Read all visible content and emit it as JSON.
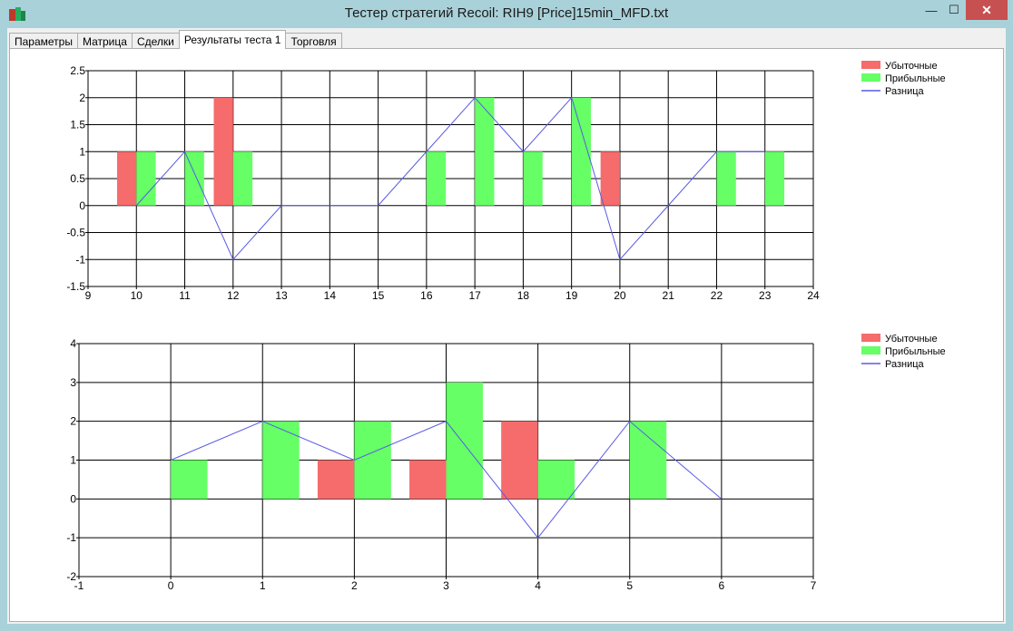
{
  "window": {
    "title": "Тестер стратегий Recoil: RIH9 [Price]15min_MFD.txt",
    "controls": {
      "minimize": "—",
      "maximize": "☐",
      "close": "✕"
    }
  },
  "tabs": [
    {
      "label": "Параметры",
      "active": false
    },
    {
      "label": "Матрица",
      "active": false
    },
    {
      "label": "Сделки",
      "active": false
    },
    {
      "label": "Результаты теста 1",
      "active": true
    },
    {
      "label": "Торговля",
      "active": false
    }
  ],
  "colors": {
    "loss": "#f66b6b",
    "profit": "#66ff66",
    "diff": "#5a5ae6",
    "grid": "#000000"
  },
  "chart_data": [
    {
      "type": "bar",
      "xlim": [
        9,
        24
      ],
      "ylim": [
        -1.5,
        2.5
      ],
      "xticks": [
        "9",
        "10",
        "11",
        "12",
        "13",
        "14",
        "15",
        "16",
        "17",
        "18",
        "19",
        "20",
        "21",
        "22",
        "23",
        "24"
      ],
      "yticks": [
        "2.5",
        "2",
        "1.5",
        "1",
        "0.5",
        "0",
        "-0.5",
        "-1",
        "-1.5"
      ],
      "xtick_values": [
        9,
        10,
        11,
        12,
        13,
        14,
        15,
        16,
        17,
        18,
        19,
        20,
        21,
        22,
        23,
        24
      ],
      "ytick_values": [
        2.5,
        2,
        1.5,
        1,
        0.5,
        0,
        -0.5,
        -1,
        -1.5
      ],
      "bar_width": 0.4,
      "legend": {
        "placement": "top-right"
      },
      "series": [
        {
          "name": "Убыточные",
          "kind": "bar",
          "offset": -0.2,
          "points": [
            [
              10,
              1
            ],
            [
              12,
              2
            ],
            [
              20,
              1
            ]
          ]
        },
        {
          "name": "Прибыльные",
          "kind": "bar",
          "offset": 0.2,
          "points": [
            [
              10,
              1
            ],
            [
              11,
              1
            ],
            [
              12,
              1
            ],
            [
              16,
              1
            ],
            [
              17,
              2
            ],
            [
              18,
              1
            ],
            [
              19,
              2
            ],
            [
              22,
              1
            ],
            [
              23,
              1
            ]
          ]
        },
        {
          "name": "Разница",
          "kind": "line",
          "points": [
            [
              10,
              0
            ],
            [
              11,
              1
            ],
            [
              12,
              -1
            ],
            [
              13,
              0
            ],
            [
              14,
              0
            ],
            [
              15,
              0
            ],
            [
              16,
              1
            ],
            [
              17,
              2
            ],
            [
              18,
              1
            ],
            [
              19,
              2
            ],
            [
              20,
              -1
            ],
            [
              21,
              0
            ],
            [
              22,
              1
            ],
            [
              23,
              1
            ]
          ]
        }
      ]
    },
    {
      "type": "bar",
      "xlim": [
        -1,
        7
      ],
      "ylim": [
        -2,
        4
      ],
      "xticks": [
        "-1",
        "0",
        "1",
        "2",
        "3",
        "4",
        "5",
        "6",
        "7"
      ],
      "yticks": [
        "4",
        "3",
        "2",
        "1",
        "0",
        "-1",
        "-2"
      ],
      "xtick_values": [
        -1,
        0,
        1,
        2,
        3,
        4,
        5,
        6,
        7
      ],
      "ytick_values": [
        4,
        3,
        2,
        1,
        0,
        -1,
        -2
      ],
      "bar_width": 0.4,
      "legend": {
        "placement": "top-right"
      },
      "series": [
        {
          "name": "Убыточные",
          "kind": "bar",
          "offset": -0.2,
          "points": [
            [
              2,
              1
            ],
            [
              3,
              1
            ],
            [
              4,
              2
            ]
          ]
        },
        {
          "name": "Прибыльные",
          "kind": "bar",
          "offset": 0.2,
          "points": [
            [
              0,
              1
            ],
            [
              1,
              2
            ],
            [
              2,
              2
            ],
            [
              3,
              3
            ],
            [
              4,
              1
            ],
            [
              5,
              2
            ]
          ]
        },
        {
          "name": "Разница",
          "kind": "line",
          "points": [
            [
              0,
              1
            ],
            [
              1,
              2
            ],
            [
              2,
              1
            ],
            [
              3,
              2
            ],
            [
              4,
              -1
            ],
            [
              5,
              2
            ],
            [
              6,
              0
            ]
          ]
        }
      ]
    }
  ]
}
